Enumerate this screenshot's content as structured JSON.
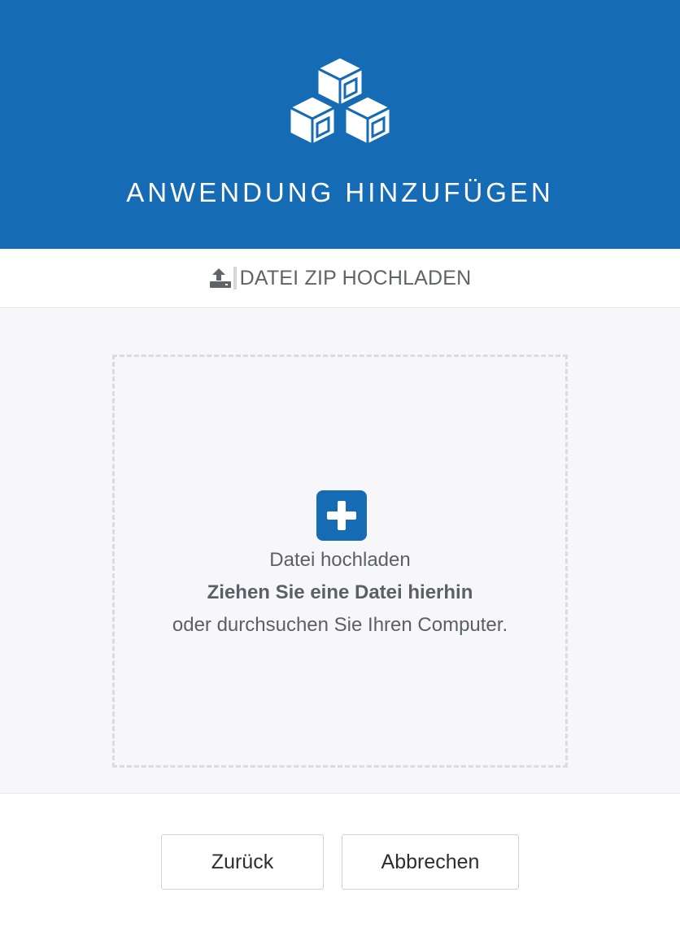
{
  "header": {
    "title": "ANWENDUNG HINZUFÜGEN",
    "icon": "cubes-icon",
    "background_color": "#166bb5"
  },
  "upload_bar": {
    "icon": "upload-icon",
    "label": "DATEI ZIP HOCHLADEN"
  },
  "dropzone": {
    "icon": "plus-icon",
    "line1": "Datei hochladen",
    "line2": "Ziehen Sie eine Datei hierhin",
    "line3": "oder durchsuchen Sie Ihren Computer."
  },
  "footer": {
    "back_label": "Zurück",
    "cancel_label": "Abbrechen"
  },
  "colors": {
    "accent": "#166bb5",
    "text_muted": "#5b6067",
    "dropzone_border": "#dcdcdf",
    "content_bg": "#f7f7f9"
  }
}
